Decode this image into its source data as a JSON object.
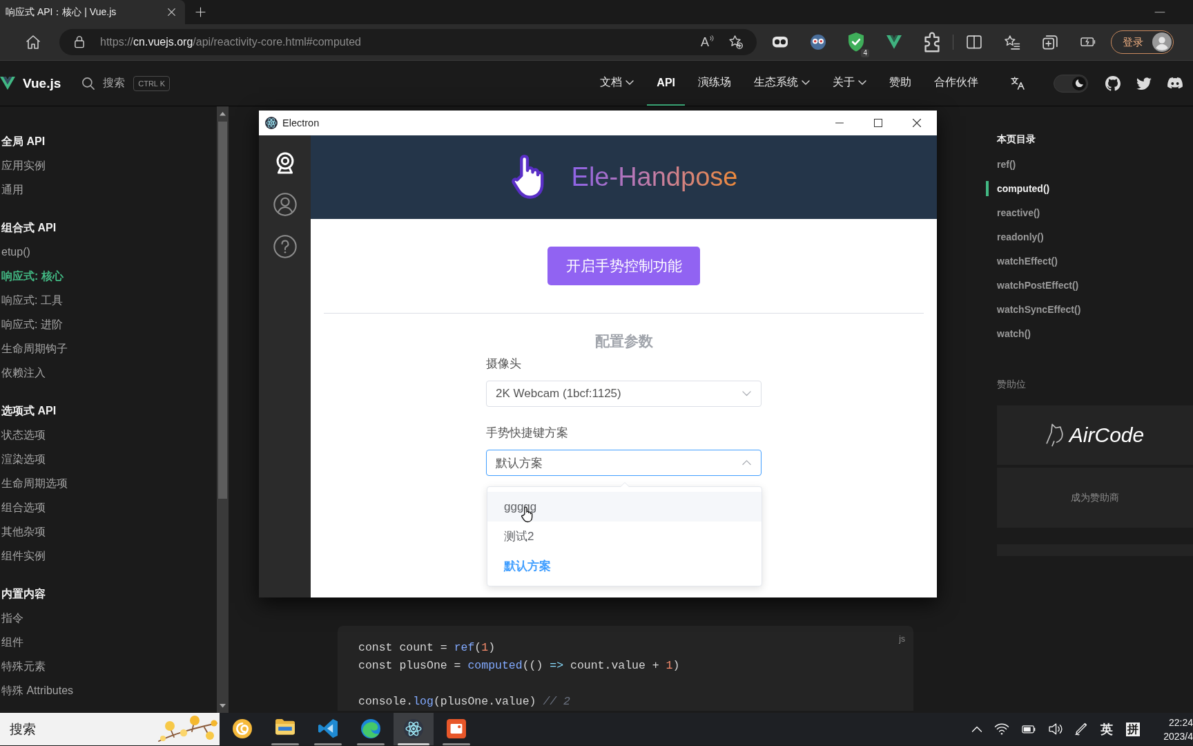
{
  "browser": {
    "tabs": [
      {
        "title": "响应式 API：核心 | Vue.js",
        "selected": true
      }
    ],
    "url_parts": [
      {
        "text": "https://",
        "emphasis": false
      },
      {
        "text": "cn.vuejs.org",
        "emphasis": true
      },
      {
        "text": "/api/reactivity-core.html#computed",
        "emphasis": false
      }
    ],
    "read_aloud": "A",
    "extension_badge": "4",
    "sign_in": "登录"
  },
  "site": {
    "logo": "Vue.js",
    "search_label": "搜索",
    "shortcut": "CTRL K",
    "nav": [
      {
        "label": "文档",
        "dropdown": true,
        "selected": false
      },
      {
        "label": "API",
        "dropdown": false,
        "selected": true
      },
      {
        "label": "演练场",
        "dropdown": false,
        "selected": false
      },
      {
        "label": "生态系统",
        "dropdown": true,
        "selected": false
      },
      {
        "label": "关于",
        "dropdown": true,
        "selected": false
      },
      {
        "label": "赞助",
        "dropdown": false,
        "selected": false
      },
      {
        "label": "合作伙伴",
        "dropdown": false,
        "selected": false
      }
    ],
    "dark_mode": {
      "on": true
    }
  },
  "sidebar": {
    "sections": [
      {
        "title": "全局 API",
        "items": [
          {
            "label": "应用实例",
            "selected": false
          },
          {
            "label": "通用",
            "selected": false
          }
        ]
      },
      {
        "title": "组合式 API",
        "items": [
          {
            "label": "etup()",
            "selected": false
          },
          {
            "label": "响应式: 核心",
            "selected": true
          },
          {
            "label": "响应式: 工具",
            "selected": false
          },
          {
            "label": "响应式: 进阶",
            "selected": false
          },
          {
            "label": "生命周期钩子",
            "selected": false
          },
          {
            "label": "依赖注入",
            "selected": false
          }
        ]
      },
      {
        "title": "选项式 API",
        "items": [
          {
            "label": "状态选项",
            "selected": false
          },
          {
            "label": "渲染选项",
            "selected": false
          },
          {
            "label": "生命周期选项",
            "selected": false
          },
          {
            "label": "组合选项",
            "selected": false
          },
          {
            "label": "其他杂项",
            "selected": false
          },
          {
            "label": "组件实例",
            "selected": false
          }
        ]
      },
      {
        "title": "内置内容",
        "items": [
          {
            "label": "指令",
            "selected": false
          },
          {
            "label": "组件",
            "selected": false
          },
          {
            "label": "特殊元素",
            "selected": false
          },
          {
            "label": "特殊 Attributes",
            "selected": false
          }
        ]
      }
    ]
  },
  "electron": {
    "title": "Electron",
    "nav": [
      {
        "kind": "camera",
        "selected": true
      },
      {
        "kind": "user",
        "selected": false
      },
      {
        "kind": "help",
        "selected": false
      }
    ],
    "app_name": "Ele-Handpose",
    "start_button": "开启手势控制功能",
    "section_title": "配置参数",
    "fields": [
      {
        "label": "摄像头",
        "value": "2K Webcam (1bcf:1125)",
        "expanded": false
      },
      {
        "label": "手势快捷键方案",
        "value": "默认方案",
        "expanded": true,
        "options": [
          {
            "label": "ggggg",
            "hovered": true,
            "selected": false
          },
          {
            "label": "测试2",
            "hovered": false,
            "selected": false
          },
          {
            "label": "默认方案",
            "hovered": false,
            "selected": true
          }
        ]
      }
    ]
  },
  "code_block": {
    "language": "js",
    "lines": [
      {
        "kind": "code",
        "tokens": [
          {
            "text": "const count = ",
            "kind": "plain"
          },
          {
            "text": "ref",
            "kind": "function"
          },
          {
            "text": "(",
            "kind": "plain"
          },
          {
            "text": "1",
            "kind": "number"
          },
          {
            "text": ")",
            "kind": "plain"
          }
        ]
      },
      {
        "kind": "code",
        "tokens": [
          {
            "text": "const plusOne = ",
            "kind": "plain"
          },
          {
            "text": "computed",
            "kind": "function"
          },
          {
            "text": "(() ",
            "kind": "plain"
          },
          {
            "text": "=>",
            "kind": "operator"
          },
          {
            "text": " count.value + ",
            "kind": "plain"
          },
          {
            "text": "1",
            "kind": "number"
          },
          {
            "text": ")",
            "kind": "plain"
          }
        ]
      },
      {
        "kind": "blank"
      },
      {
        "kind": "code",
        "tokens": [
          {
            "text": "console.",
            "kind": "plain"
          },
          {
            "text": "log",
            "kind": "function"
          },
          {
            "text": "(plusOne.value) ",
            "kind": "plain"
          },
          {
            "text": "// 2",
            "kind": "comment"
          }
        ]
      }
    ]
  },
  "toc": {
    "title": "本页目录",
    "items": [
      {
        "label": "ref()",
        "selected": false
      },
      {
        "label": "computed()",
        "selected": true
      },
      {
        "label": "reactive()",
        "selected": false
      },
      {
        "label": "readonly()",
        "selected": false
      },
      {
        "label": "watchEffect()",
        "selected": false
      },
      {
        "label": "watchPostEffect()",
        "selected": false
      },
      {
        "label": "watchSyncEffect()",
        "selected": false
      },
      {
        "label": "watch()",
        "selected": false
      }
    ]
  },
  "sponsors": {
    "title": "赞助位",
    "cards": [
      {
        "kind": "logo",
        "label": "AirCode"
      },
      {
        "kind": "text",
        "label": "成为赞助商"
      },
      {
        "kind": "blank"
      }
    ]
  },
  "taskbar": {
    "search": {
      "placeholder": "搜索"
    },
    "apps": [
      {
        "kind": "swirl",
        "selected": false,
        "running": false
      },
      {
        "kind": "folder",
        "selected": false,
        "running": true
      },
      {
        "kind": "ribbon",
        "selected": false,
        "running": true
      },
      {
        "kind": "wave",
        "selected": false,
        "running": true
      },
      {
        "kind": "atom",
        "selected": true,
        "running": true
      },
      {
        "kind": "tile",
        "selected": false,
        "running": true
      }
    ],
    "input_mode": "英",
    "ime": "拼",
    "time": "22:24",
    "date": "2023/4"
  }
}
